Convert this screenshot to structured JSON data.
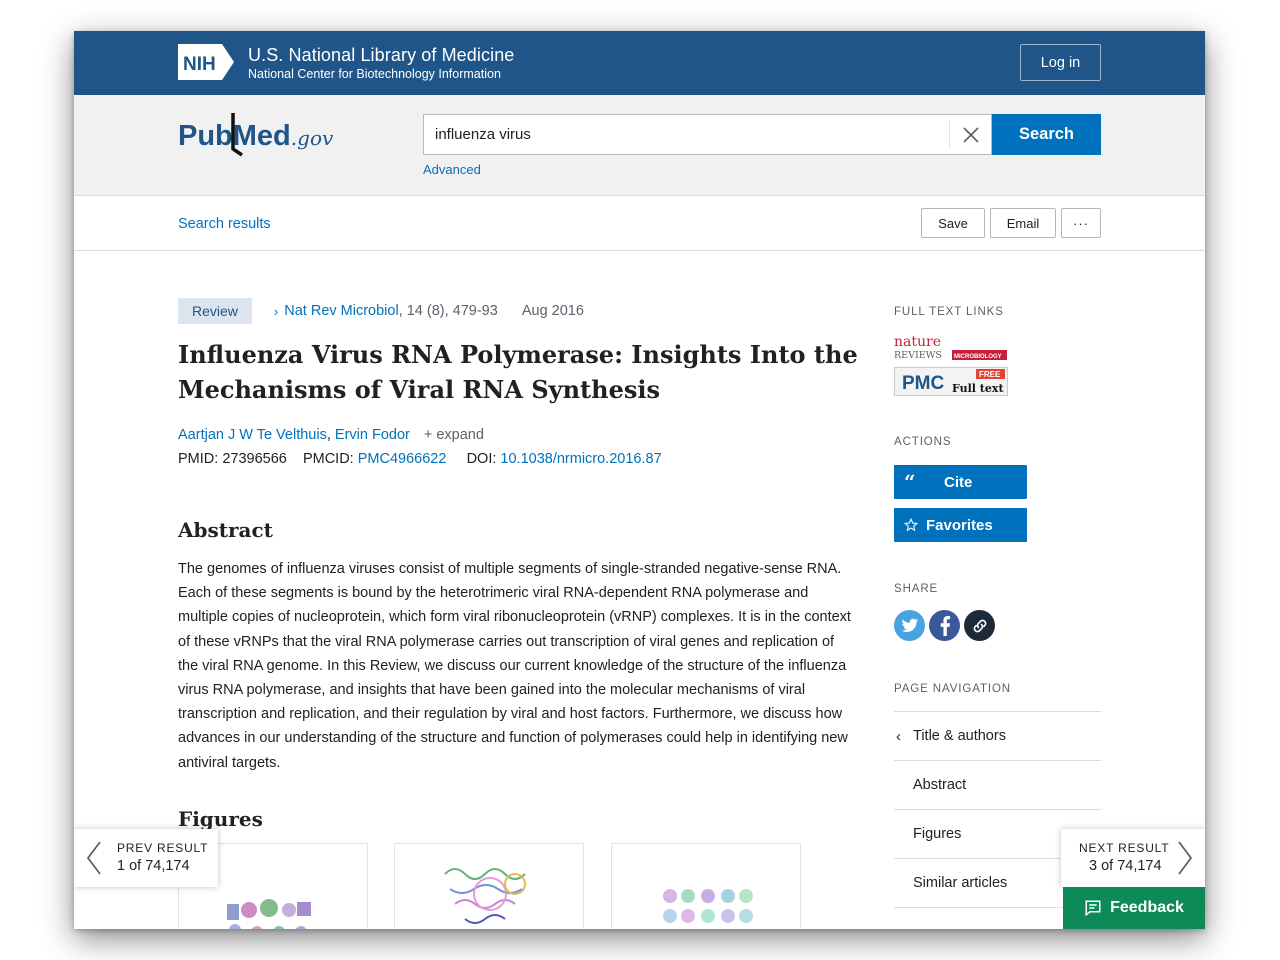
{
  "nih_banner": {
    "logo_text": "NIH",
    "title": "U.S. National Library of Medicine",
    "subtitle": "National Center for Biotechnology Information",
    "login_label": "Log in"
  },
  "search_header": {
    "logo_main": "PubMed",
    "logo_suffix": ".gov",
    "query": "influenza virus",
    "search_label": "Search",
    "advanced_label": "Advanced"
  },
  "toolbar": {
    "back_link": "Search results",
    "save_label": "Save",
    "email_label": "Email",
    "more_label": "···"
  },
  "article": {
    "badge": "Review",
    "journal": "Nat Rev Microbiol",
    "citation": ", 14 (8), 479-93",
    "date": "Aug 2016",
    "title": "Influenza Virus RNA Polymerase: Insights Into the Mechanisms of Viral RNA Synthesis",
    "authors": [
      "Aartjan J W Te Velthuis",
      "Ervin Fodor"
    ],
    "expand_label": "+ expand",
    "pmid_label": "PMID:",
    "pmid": "27396566",
    "pmcid_label": "PMCID:",
    "pmcid": "PMC4966622",
    "doi_label": "DOI:",
    "doi": "10.1038/nrmicro.2016.87",
    "abstract_heading": "Abstract",
    "abstract_text": "The genomes of influenza viruses consist of multiple segments of single-stranded negative-sense RNA. Each of these segments is bound by the heterotrimeric viral RNA-dependent RNA polymerase and multiple copies of nucleoprotein, which form viral ribonucleoprotein (vRNP) complexes. It is in the context of these vRNPs that the viral RNA polymerase carries out transcription of viral genes and replication of the viral RNA genome. In this Review, we discuss our current knowledge of the structure of the influenza virus RNA polymerase, and insights that have been gained into the molecular mechanisms of viral transcription and replication, and their regulation by viral and host factors. Furthermore, we discuss how advances in our understanding of the structure and function of polymerases could help in identifying new antiviral targets.",
    "figures_heading": "Figures"
  },
  "sidebar": {
    "full_text_heading": "FULL TEXT LINKS",
    "nature_logo_top": "nature",
    "nature_logo_bottom": "REVIEWS",
    "nature_logo_tag": "MICROBIOLOGY",
    "pmc_logo": "PMC",
    "pmc_free": "FREE",
    "pmc_fulltext": "Full text",
    "actions_heading": "ACTIONS",
    "cite_label": "Cite",
    "favorites_label": "Favorites",
    "share_heading": "SHARE",
    "page_nav_heading": "PAGE NAVIGATION",
    "nav_items": [
      "Title & authors",
      "Abstract",
      "Figures",
      "Similar articles"
    ]
  },
  "pager": {
    "prev_label": "PREV RESULT",
    "prev_count": "1 of 74,174",
    "next_label": "NEXT RESULT",
    "next_count": "3 of 74,174"
  },
  "feedback_label": "Feedback",
  "colors": {
    "nih_blue": "#20558a",
    "link_blue": "#0071bc",
    "feedback_green": "#0d8a57",
    "review_badge_bg": "#dce4ef"
  }
}
